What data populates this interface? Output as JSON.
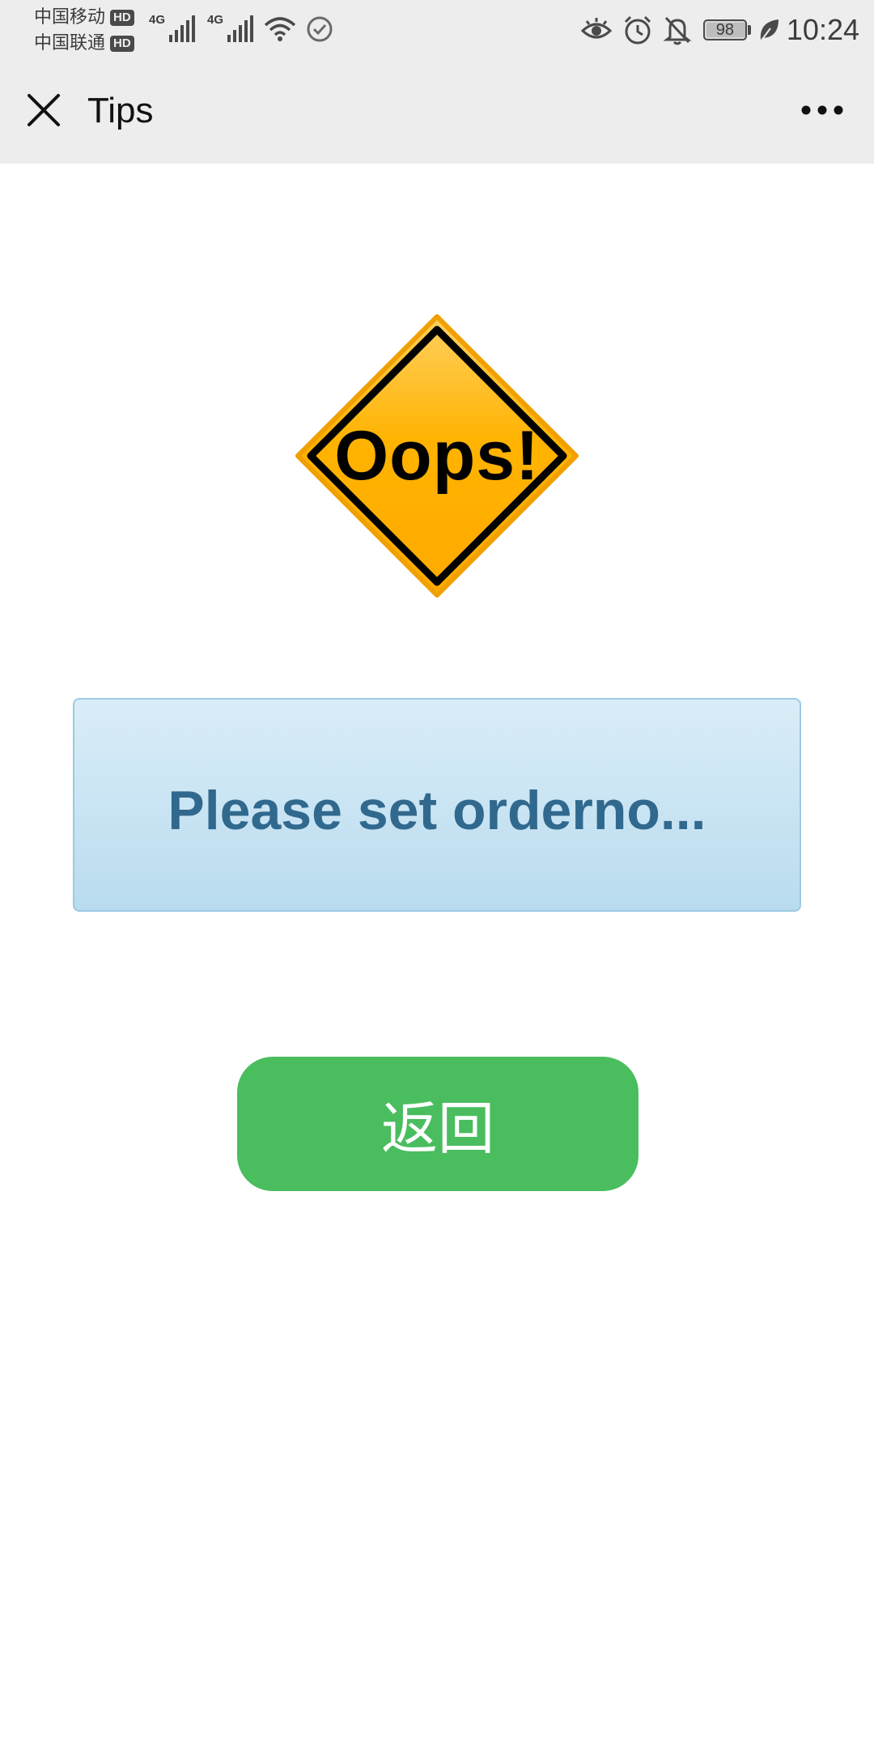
{
  "status_bar": {
    "carrier_1": "中国移动",
    "carrier_2": "中国联通",
    "hd_badge": "HD",
    "network_label_1": "4G",
    "network_label_2": "4G",
    "battery_level": "98",
    "time": "10:24",
    "icons": [
      "signal-icon",
      "wifi-icon",
      "check-circle-icon",
      "eye-icon",
      "alarm-icon",
      "bell-off-icon",
      "battery-icon",
      "leaf-icon"
    ]
  },
  "title_bar": {
    "title": "Tips",
    "close_icon": "close-icon",
    "more_icon": "more-icon"
  },
  "main": {
    "sign_text": "Oops!",
    "message": "Please set orderno...",
    "back_button_label": "返回"
  },
  "colors": {
    "bar_background": "#ededed",
    "sign_fill": "#ffb200",
    "message_text": "#31698e",
    "message_border": "#9cc9e3",
    "button_green": "#4abd5f"
  }
}
